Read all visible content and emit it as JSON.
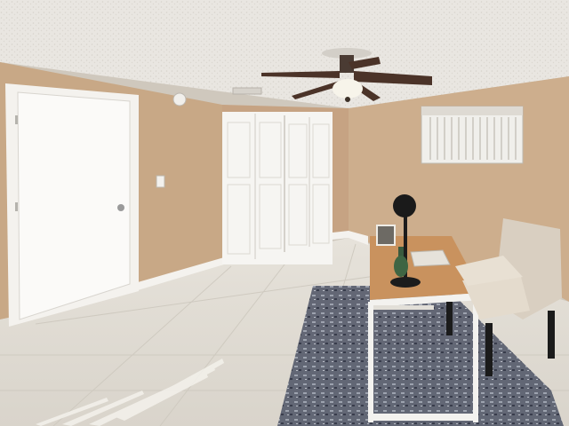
{
  "image": {
    "kind": "photo",
    "subject": "home-office-room",
    "colors": {
      "ceiling": "#e9e6e1",
      "wall_left": "#c8a886",
      "wall_back": "#c6a383",
      "wall_right": "#cdae8d",
      "floor": "#e1ddd5",
      "trim": "#f4f2ee",
      "desk_top": "#c9925e",
      "desk_frame": "#f3f2ef",
      "chair": "#d9cfc1",
      "rug": "#5c6170"
    }
  }
}
